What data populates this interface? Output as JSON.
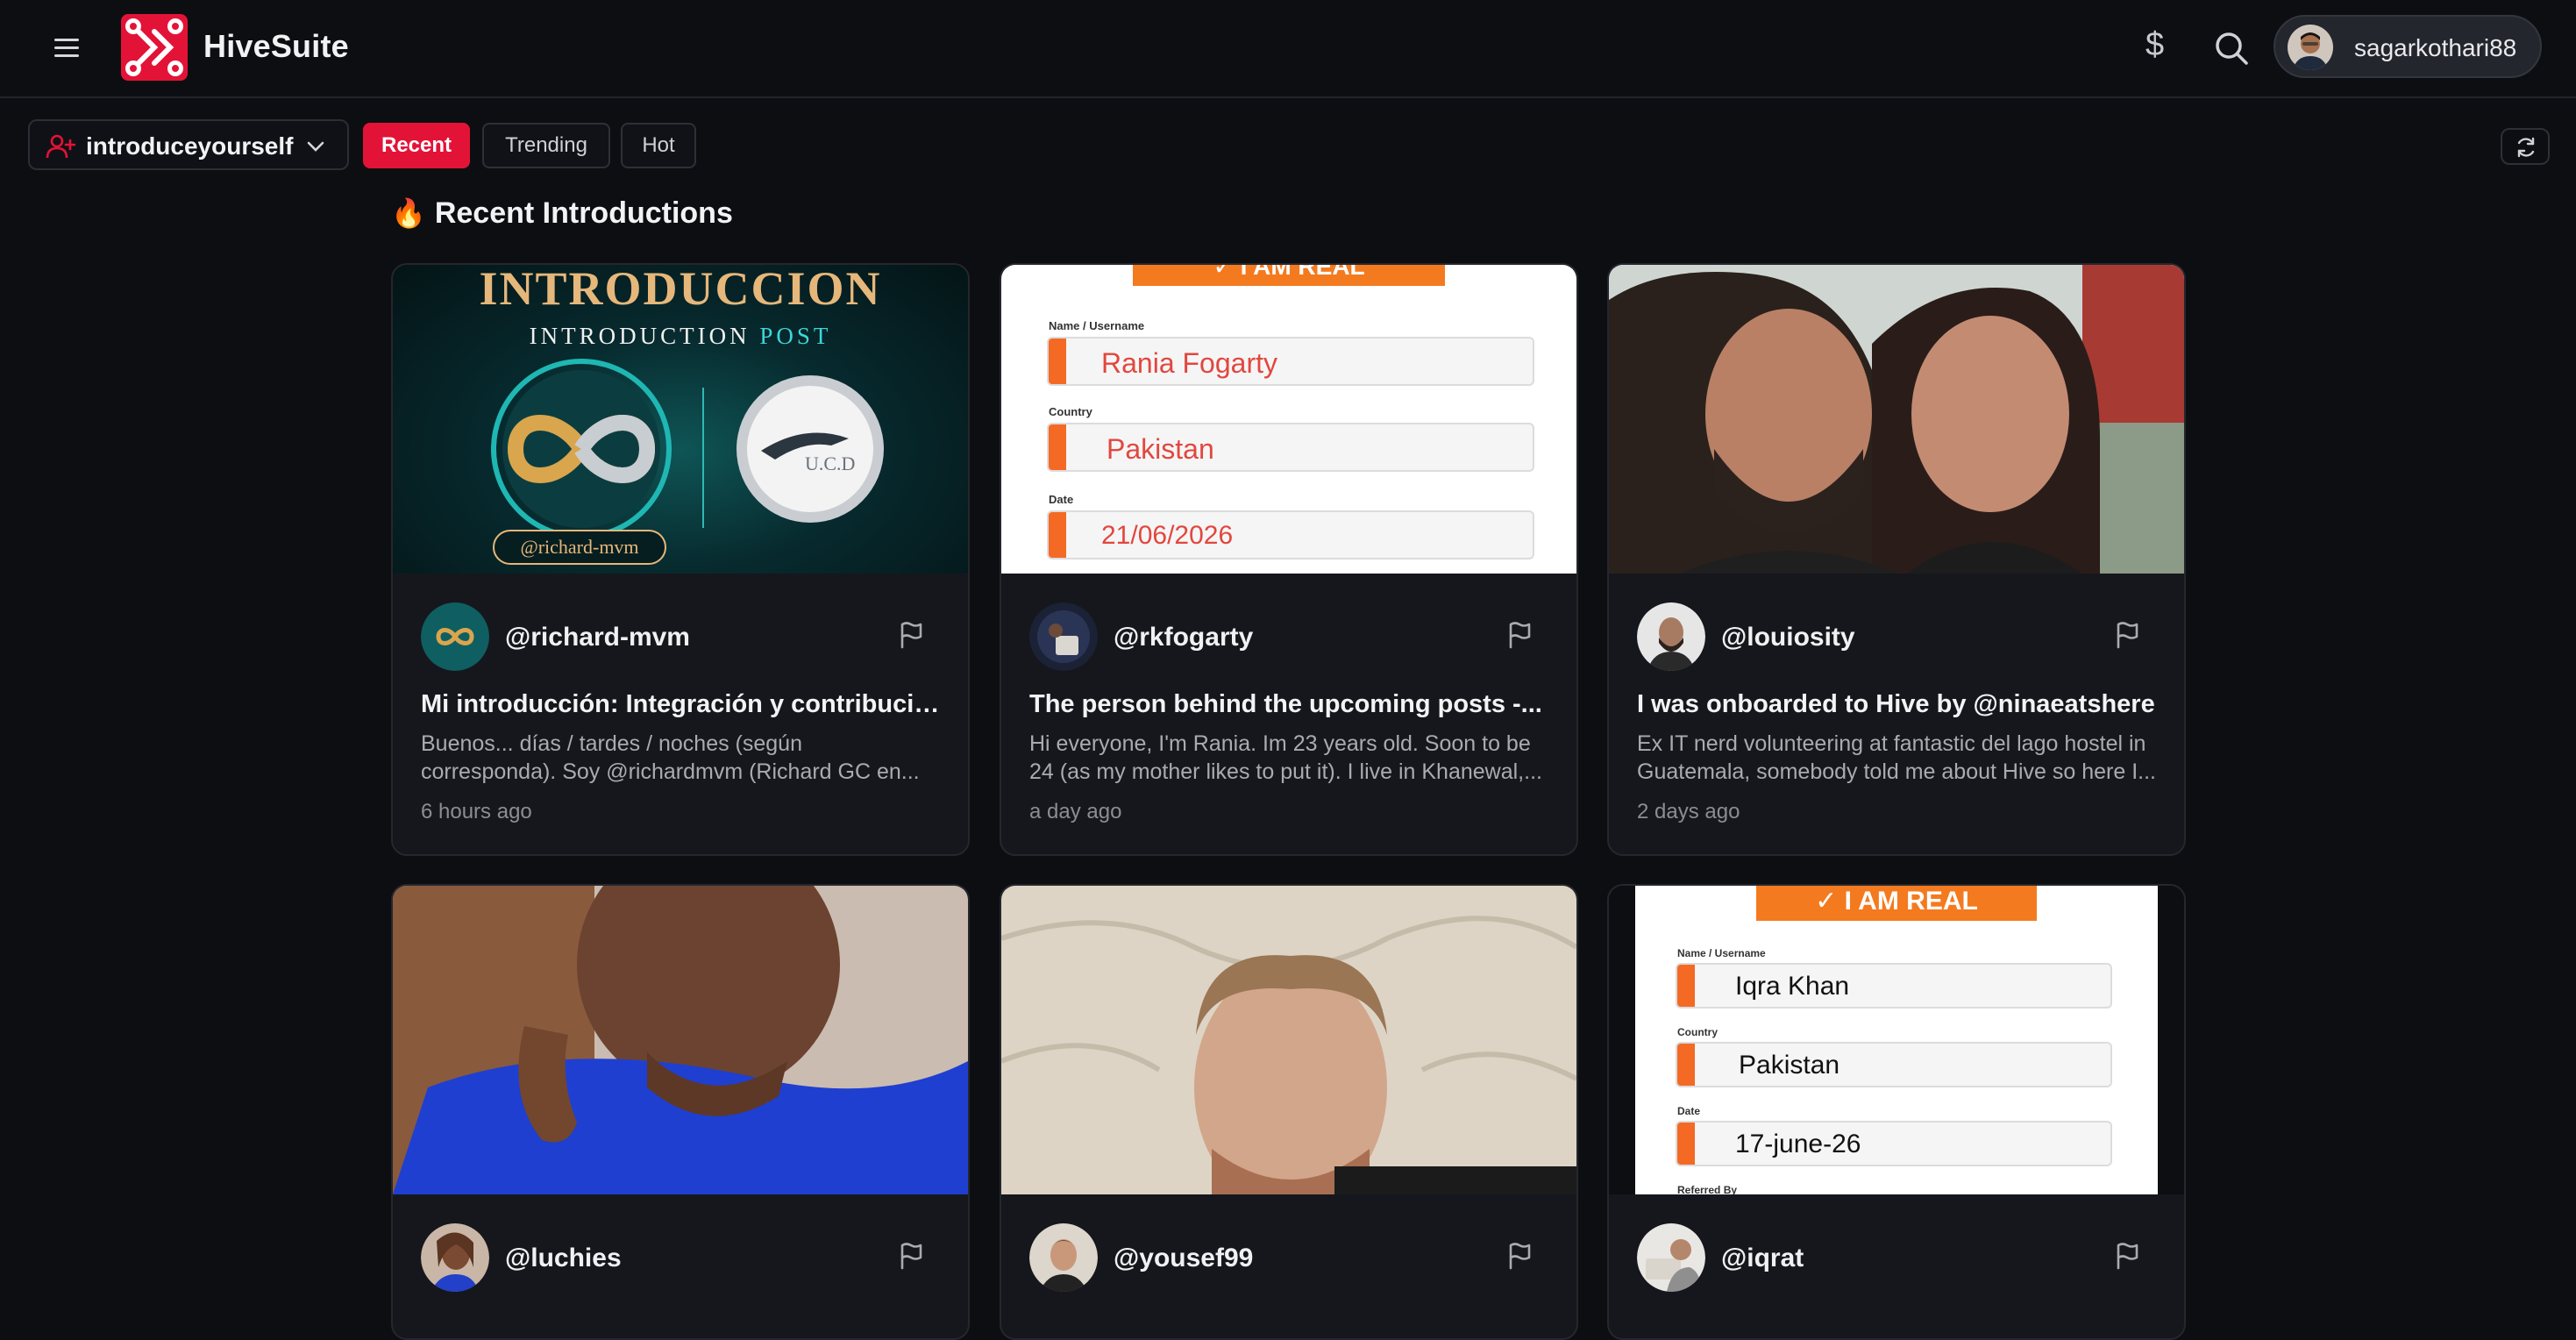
{
  "app": {
    "name": "HiveSuite"
  },
  "header": {
    "currency_symbol": "$",
    "username": "sagarkothari88"
  },
  "filters": {
    "community": "introduceyourself",
    "tabs": [
      {
        "label": "Recent",
        "active": true
      },
      {
        "label": "Trending",
        "active": false
      },
      {
        "label": "Hot",
        "active": false
      }
    ]
  },
  "section": {
    "title": "Recent Introductions",
    "emoji": "🔥"
  },
  "colors": {
    "accent": "#e31337",
    "background": "#0d0e12",
    "card": "#16171c",
    "form_orange": "#f46a24"
  },
  "posts": [
    {
      "author": "@richard-mvm",
      "title": "Mi introducción: Integración y contribució...",
      "excerpt": "Buenos... días / tardes / noches (según corresponda). Soy @richardmvm (Richard GC en...",
      "time": "6 hours ago",
      "thumbnail": {
        "heading": "INTRODUCCION",
        "subheading": "INTRODUCTION",
        "subheading_accent": "POST",
        "tag": "@richard-mvm",
        "badge_text": "U.C.D"
      }
    },
    {
      "author": "@rkfogarty",
      "title": "The person behind the upcoming posts -...",
      "excerpt": "Hi everyone, I'm Rania. Im 23 years old. Soon to be 24 (as my mother likes to put it). I live in Khanewal,...",
      "time": "a day ago",
      "thumbnail": {
        "banner": "✓ I AM REAL",
        "label_name": "Name / Username",
        "name": "Rania Fogarty",
        "label_country": "Country",
        "country": "Pakistan",
        "label_date": "Date",
        "date": "21/06/2026"
      }
    },
    {
      "author": "@louiosity",
      "title": "I was onboarded to Hive by @ninaeatshere",
      "excerpt": "Ex IT nerd volunteering at fantastic del lago hostel in Guatemala, somebody told me about Hive so here I...",
      "time": "2 days ago"
    },
    {
      "author": "@luchies"
    },
    {
      "author": "@yousef99"
    },
    {
      "author": "@iqrat",
      "thumbnail": {
        "banner": "✓ I AM REAL",
        "label_name": "Name / Username",
        "name": "Iqra Khan",
        "label_country": "Country",
        "country": "Pakistan",
        "label_date": "Date",
        "date": "17-june-26",
        "label_referred": "Referred By"
      }
    }
  ],
  "icons": [
    "menu-icon",
    "hive-logo-icon",
    "dollar-icon",
    "search-icon",
    "user-plus-icon",
    "chevron-down-icon",
    "refresh-icon",
    "flag-icon",
    "fire-icon"
  ]
}
